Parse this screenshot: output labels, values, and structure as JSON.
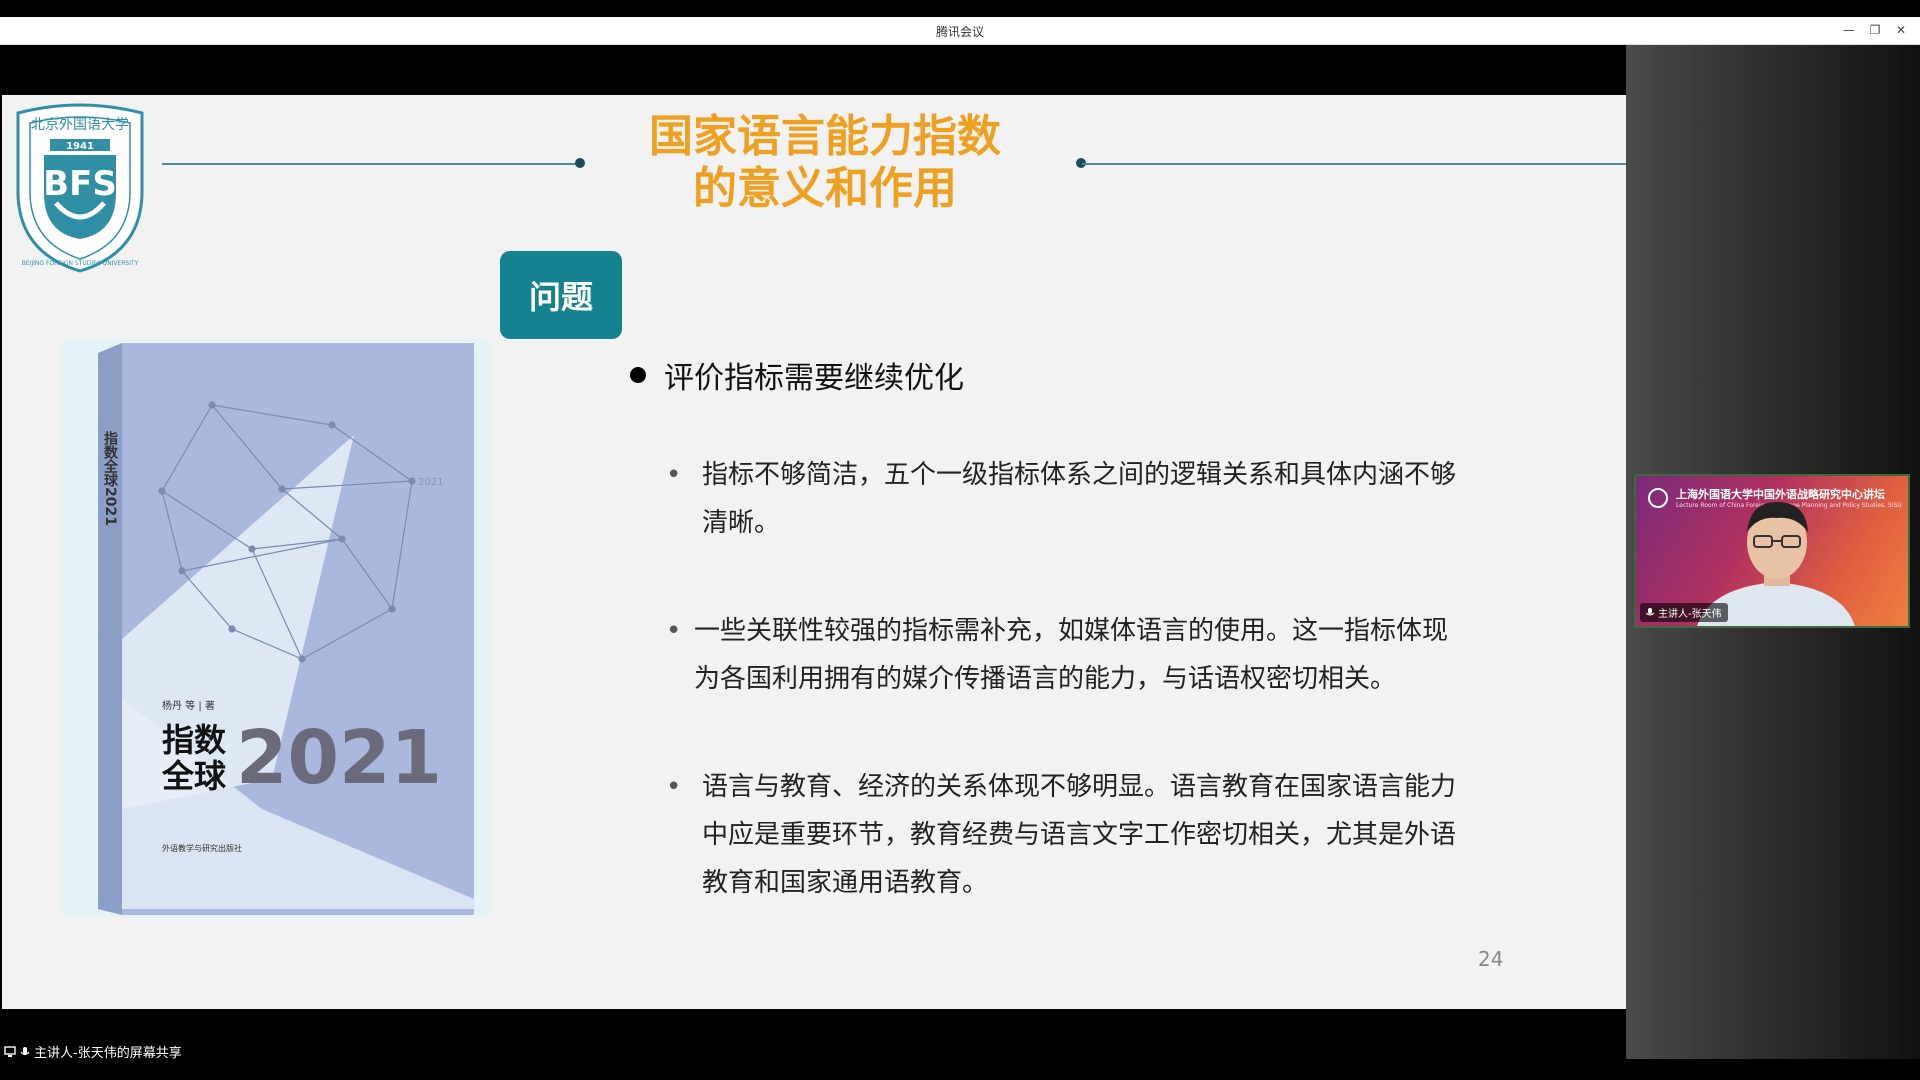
{
  "window": {
    "title": "腾讯会议",
    "minimize": "—",
    "restore": "❐",
    "close": "✕"
  },
  "slide": {
    "title_line1": "国家语言能力指数",
    "title_line2": "的意义和作用",
    "tag": "问题",
    "main_point": "评价指标需要继续优化",
    "sub_points": [
      {
        "bullet": "•",
        "line1": "指标不够简洁，五个一级指标体系之间的逻辑关系和具体内涵不够",
        "line2": "清晰。"
      },
      {
        "bullet": "•",
        "line1": "一些关联性较强的指标需补充，如媒体语言的使用。这一指标体现",
        "line2": "为各国利用拥有的媒介传播语言的能力，与话语权密切相关。"
      },
      {
        "bullet": "•",
        "line1": "语言与教育、经济的关系体现不够明显。语言教育在国家语言能力",
        "line2": "中应是重要环节，教育经费与语言文字工作密切相关，尤其是外语",
        "line3": "教育和国家通用语教育。"
      }
    ],
    "page_number": "24",
    "logo": {
      "text_top": "北京外国语大学",
      "year": "1941",
      "initials": "BFS",
      "ring_text": "BEIJING FOREIGN STUDIES UNIVERSITY"
    },
    "book": {
      "spine": "指数全球2021",
      "authors": "杨丹 等 | 著",
      "title_a": "指数",
      "title_b": "全球",
      "year": "2021",
      "side_year": "2021",
      "publisher": "外语教学与研究出版社"
    }
  },
  "toolbar": {
    "toc_icon": "☰"
  },
  "share": {
    "label": "主讲人-张天伟的屏幕共享"
  },
  "video": {
    "banner": "上海外国语大学中国外语战略研究中心讲坛",
    "banner_sub": "Lecture Room of China Foreign Language Planning and Policy Studies, SISU",
    "name": "主讲人-张天伟"
  }
}
